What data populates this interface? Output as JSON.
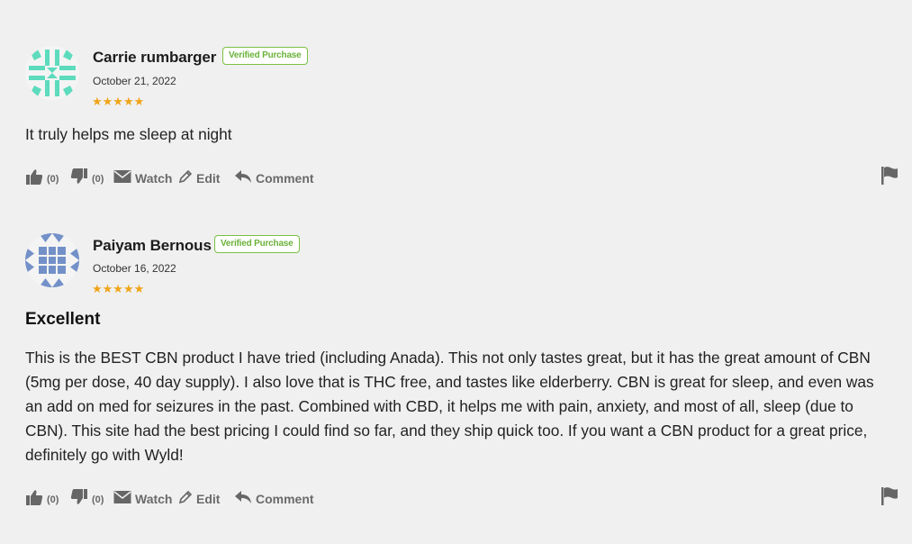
{
  "reviews": [
    {
      "author": "Carrie rumbarger",
      "badge": "Verified Purchase",
      "date": "October 21, 2022",
      "rating": 5,
      "stars": "★★★★★",
      "title": "",
      "body": "It truly helps me sleep at night",
      "likes": "(0)",
      "dislikes": "(0)",
      "avatar_color": "#5ddbbd"
    },
    {
      "author": "Paiyam Bernous",
      "badge": "Verified Purchase",
      "date": "October 16, 2022",
      "rating": 5,
      "stars": "★★★★★",
      "title": "Excellent",
      "body": "This is the BEST CBN product I have tried (including Anada). This not only tastes great, but it has the great amount of CBN (5mg per dose, 40 day supply). I also love that is THC free, and tastes like elderberry. CBN is great for sleep, and even was an add on med for seizures in the past. Combined with CBD, it helps me with pain, anxiety, and most of all, sleep (due to CBN). This site had the best pricing I could find so far, and they ship quick too. If you want a CBN product for a great price, definitely go with Wyld!",
      "likes": "(0)",
      "dislikes": "(0)",
      "avatar_color": "#7391c8"
    }
  ],
  "actions": {
    "watch_label": "Watch",
    "edit_label": "Edit",
    "comment_label": "Comment"
  },
  "colors": {
    "badge_green": "#7ac043",
    "star_orange": "#f0a417",
    "action_gray": "#666666",
    "background": "#f0f0f0"
  },
  "icons": [
    "thumbs-up-icon",
    "thumbs-down-icon",
    "envelope-icon",
    "pencil-icon",
    "reply-icon",
    "flag-icon"
  ]
}
